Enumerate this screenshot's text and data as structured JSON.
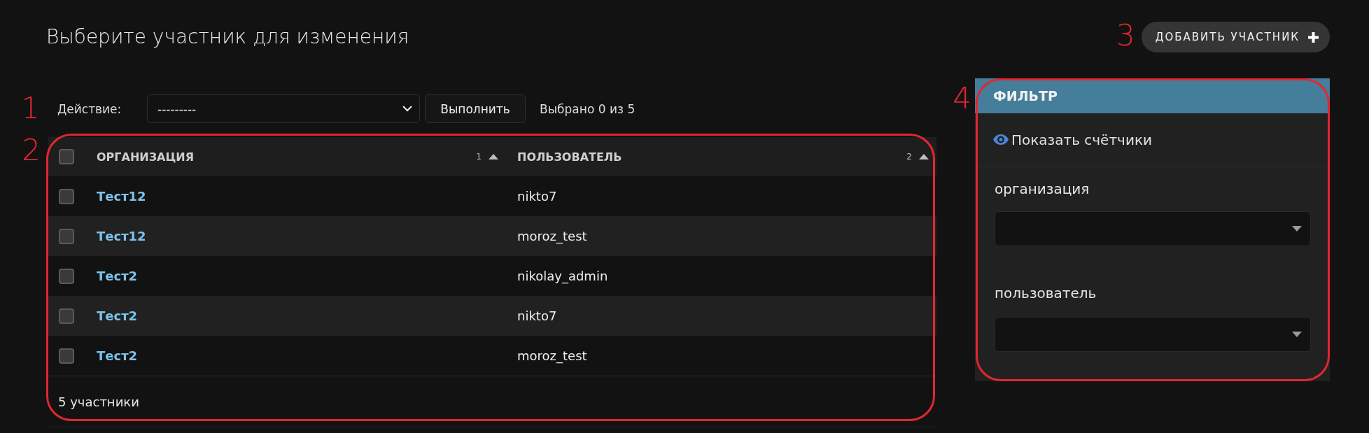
{
  "page": {
    "title": "Выберите участник для изменения"
  },
  "add_button": {
    "label": "ДОБАВИТЬ УЧАСТНИК",
    "annotation": {
      "label": "3"
    }
  },
  "actions": {
    "label": "Действие:",
    "select_value": "---------",
    "run_button": "Выполнить",
    "selection_count": "Выбрано 0 из 5",
    "annotation": {
      "label": "1"
    }
  },
  "table": {
    "select_all_checked": false,
    "columns": [
      {
        "label": "ОРГАНИЗАЦИЯ",
        "sort_priority": "1",
        "ascending": true
      },
      {
        "label": "ПОЛЬЗОВАТЕЛЬ",
        "sort_priority": "2",
        "ascending": true
      }
    ],
    "rows": [
      {
        "checked": false,
        "organization": "Тест12",
        "user": "nikto7"
      },
      {
        "checked": false,
        "organization": "Тест12",
        "user": "moroz_test"
      },
      {
        "checked": false,
        "organization": "Тест2",
        "user": "nikolay_admin"
      },
      {
        "checked": false,
        "organization": "Тест2",
        "user": "nikto7"
      },
      {
        "checked": false,
        "organization": "Тест2",
        "user": "moroz_test"
      }
    ],
    "footer": "5 участники",
    "annotation": {
      "label": "2",
      "outline": true
    }
  },
  "filter": {
    "title": "ФИЛЬТР",
    "show_counts": "Показать счётчики",
    "fields": [
      {
        "label": "организация"
      },
      {
        "label": "пользователь"
      }
    ],
    "annotation": {
      "label": "4",
      "outline": true
    }
  }
}
